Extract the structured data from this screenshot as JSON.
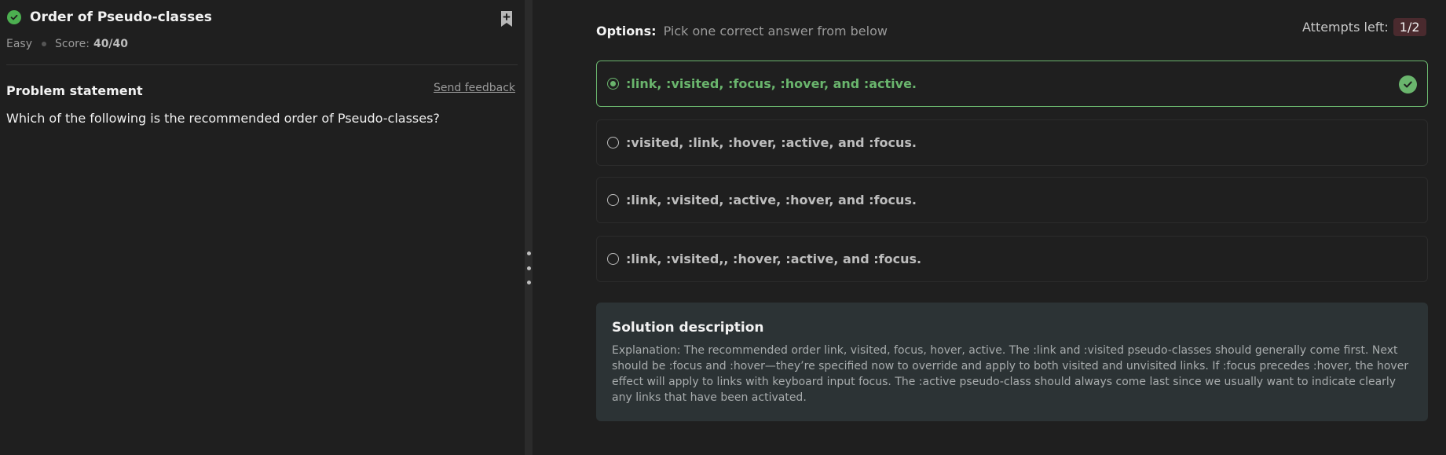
{
  "problem": {
    "title": "Order of Pseudo-classes",
    "difficulty": "Easy",
    "score_label": "Score:",
    "score_value": "40/40"
  },
  "statement": {
    "heading": "Problem statement",
    "feedback_link": "Send feedback",
    "question": "Which of the following is the recommended order of Pseudo-classes?"
  },
  "options_header": {
    "label": "Options:",
    "hint": "Pick one correct answer from below",
    "attempts_label": "Attempts left:",
    "attempts_value": "1/2"
  },
  "options": [
    {
      "text": ":link, :visited, :focus, :hover, and :active.",
      "selected": true,
      "correct": true
    },
    {
      "text": ":visited, :link, :hover, :active, and :focus.",
      "selected": false,
      "correct": false
    },
    {
      "text": ":link, :visited, :active, :hover, and :focus.",
      "selected": false,
      "correct": false
    },
    {
      "text": ":link, :visited,, :hover, :active, and :focus.",
      "selected": false,
      "correct": false
    }
  ],
  "solution": {
    "heading": "Solution description",
    "text": "Explanation: The recommended order link, visited, focus, hover, active. The :link and :visited pseudo-classes should generally come first. Next should be :focus and :hover—they’re specified now to override and apply to both visited and unvisited links. If :focus precedes :hover, the hover effect will apply to links with keyboard input focus. The :active pseudo-class should always come last since we usually want to indicate clearly any links that have been activated."
  },
  "colors": {
    "correct_green": "#6ab56d",
    "status_green": "#4caf50",
    "attempts_badge": "#4a2a2e",
    "solution_bg": "#2c3335"
  },
  "icons": [
    "check-circle-icon",
    "bookmark-add-icon",
    "radio-selected-icon",
    "radio-empty-icon",
    "checkmark-icon",
    "drag-handle-icon"
  ]
}
